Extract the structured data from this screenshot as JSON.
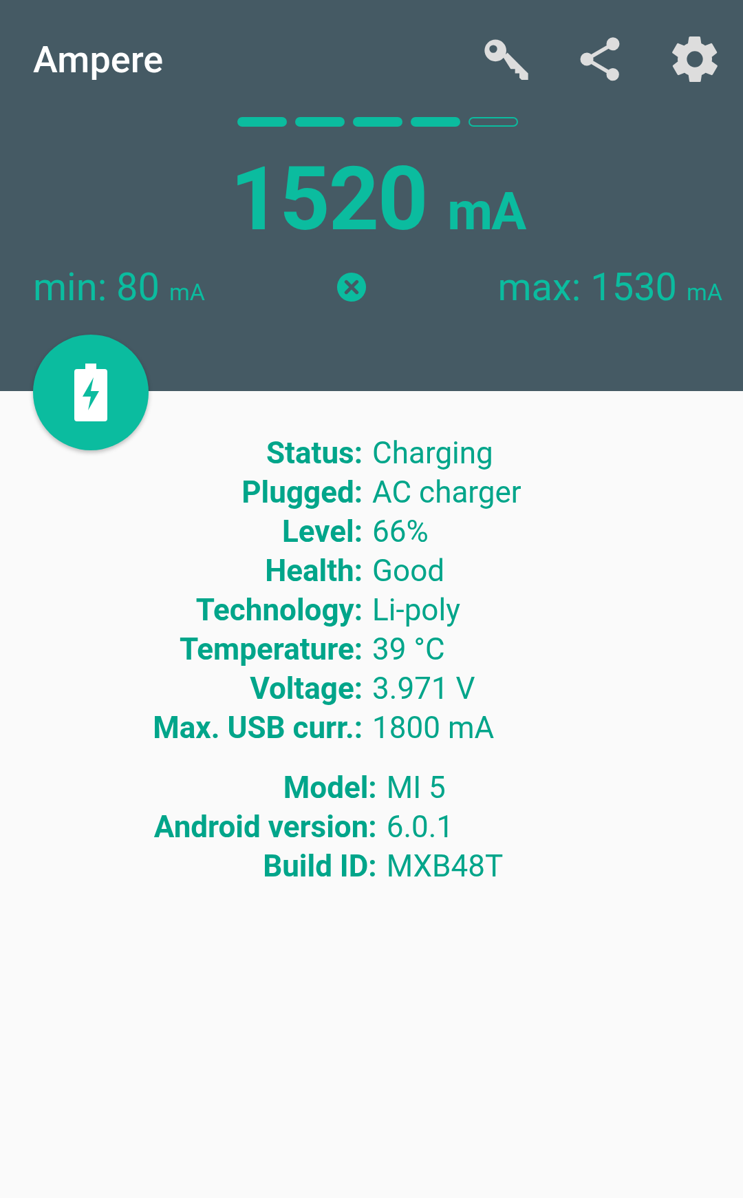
{
  "app_bar": {
    "title": "Ampere"
  },
  "meter": {
    "segments": [
      {
        "filled": true
      },
      {
        "filled": true
      },
      {
        "filled": true
      },
      {
        "filled": true
      },
      {
        "filled": false
      }
    ],
    "current": "1520",
    "current_unit": "mA",
    "min_label": "min:",
    "min_value": "80",
    "min_unit": "mA",
    "max_label": "max:",
    "max_value": "1530",
    "max_unit": "mA"
  },
  "battery_info": [
    {
      "label": "Status:",
      "value": "Charging"
    },
    {
      "label": "Plugged:",
      "value": "AC charger"
    },
    {
      "label": "Level:",
      "value": "66%"
    },
    {
      "label": "Health:",
      "value": "Good"
    },
    {
      "label": "Technology:",
      "value": "Li-poly"
    },
    {
      "label": "Temperature:",
      "value": "39 °C"
    },
    {
      "label": "Voltage:",
      "value": "3.971 V"
    },
    {
      "label": "Max. USB curr.:",
      "value": "1800 mA"
    }
  ],
  "device_info": [
    {
      "label": "Model:",
      "value": "MI 5"
    },
    {
      "label": "Android version:",
      "value": "6.0.1"
    },
    {
      "label": "Build ID:",
      "value": "MXB48T"
    }
  ]
}
